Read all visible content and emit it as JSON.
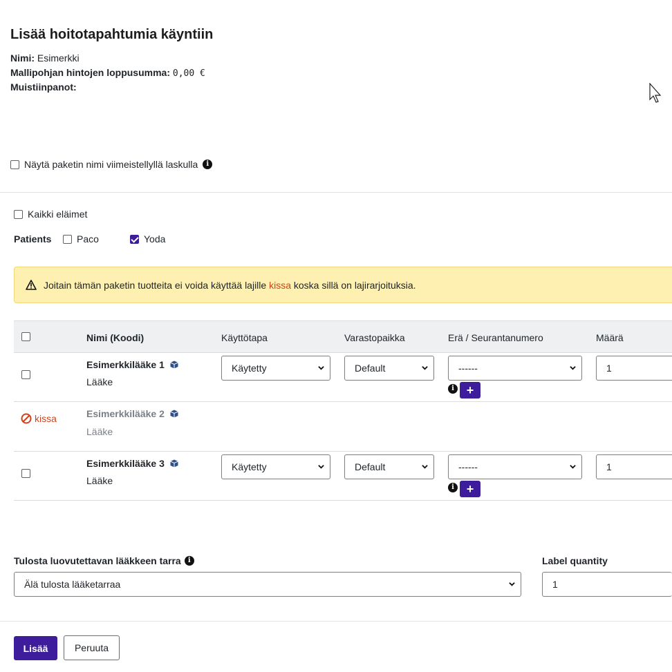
{
  "header": {
    "title": "Lisää hoitotapahtumia käyntiin",
    "name_label": "Nimi:",
    "name_value": "Esimerkki",
    "price_label": "Mallipohjan hintojen loppusumma:",
    "price_value": "0,00 €",
    "notes_label": "Muistiinpanot:"
  },
  "options": {
    "show_package_name": "Näytä paketin nimi viimeistellyllä laskulla",
    "show_package_checked": false,
    "all_animals": "Kaikki eläimet",
    "all_animals_checked": false,
    "patients_label": "Patients",
    "patients": [
      {
        "name": "Paco",
        "checked": false
      },
      {
        "name": "Yoda",
        "checked": true
      }
    ]
  },
  "warning": {
    "text_before": "Joitain tämän paketin tuotteita ei voida käyttää lajille",
    "species": "kissa",
    "text_after": "koska sillä on lajirarjoituksia."
  },
  "table": {
    "columns": [
      "Nimi (Koodi)",
      "Käyttötapa",
      "Varastopaikka",
      "Erä / Seurantanumero",
      "Määrä"
    ],
    "rows": [
      {
        "name": "Esimerkkilääke 1",
        "type": "Lääke",
        "usage": "Käytetty",
        "storage": "Default",
        "batch": "------",
        "quantity": "1",
        "blocked": false
      },
      {
        "name": "Esimerkkilääke 2",
        "type": "Lääke",
        "blocked": true,
        "blocked_label": "kissa"
      },
      {
        "name": "Esimerkkilääke 3",
        "type": "Lääke",
        "usage": "Käytetty",
        "storage": "Default",
        "batch": "------",
        "quantity": "1",
        "blocked": false
      }
    ],
    "plus_label": "+"
  },
  "label_print": {
    "label": "Tulosta luovutettavan lääkkeen tarra",
    "value": "Älä tulosta lääketarraa",
    "quantity_label": "Label quantity",
    "quantity_value": "1"
  },
  "footer": {
    "add_label": "Lisää",
    "cancel_label": "Peruuta"
  },
  "colors": {
    "primary": "#3d1d9b",
    "warning_bg": "#fdf0b0",
    "danger": "#d0421b"
  }
}
